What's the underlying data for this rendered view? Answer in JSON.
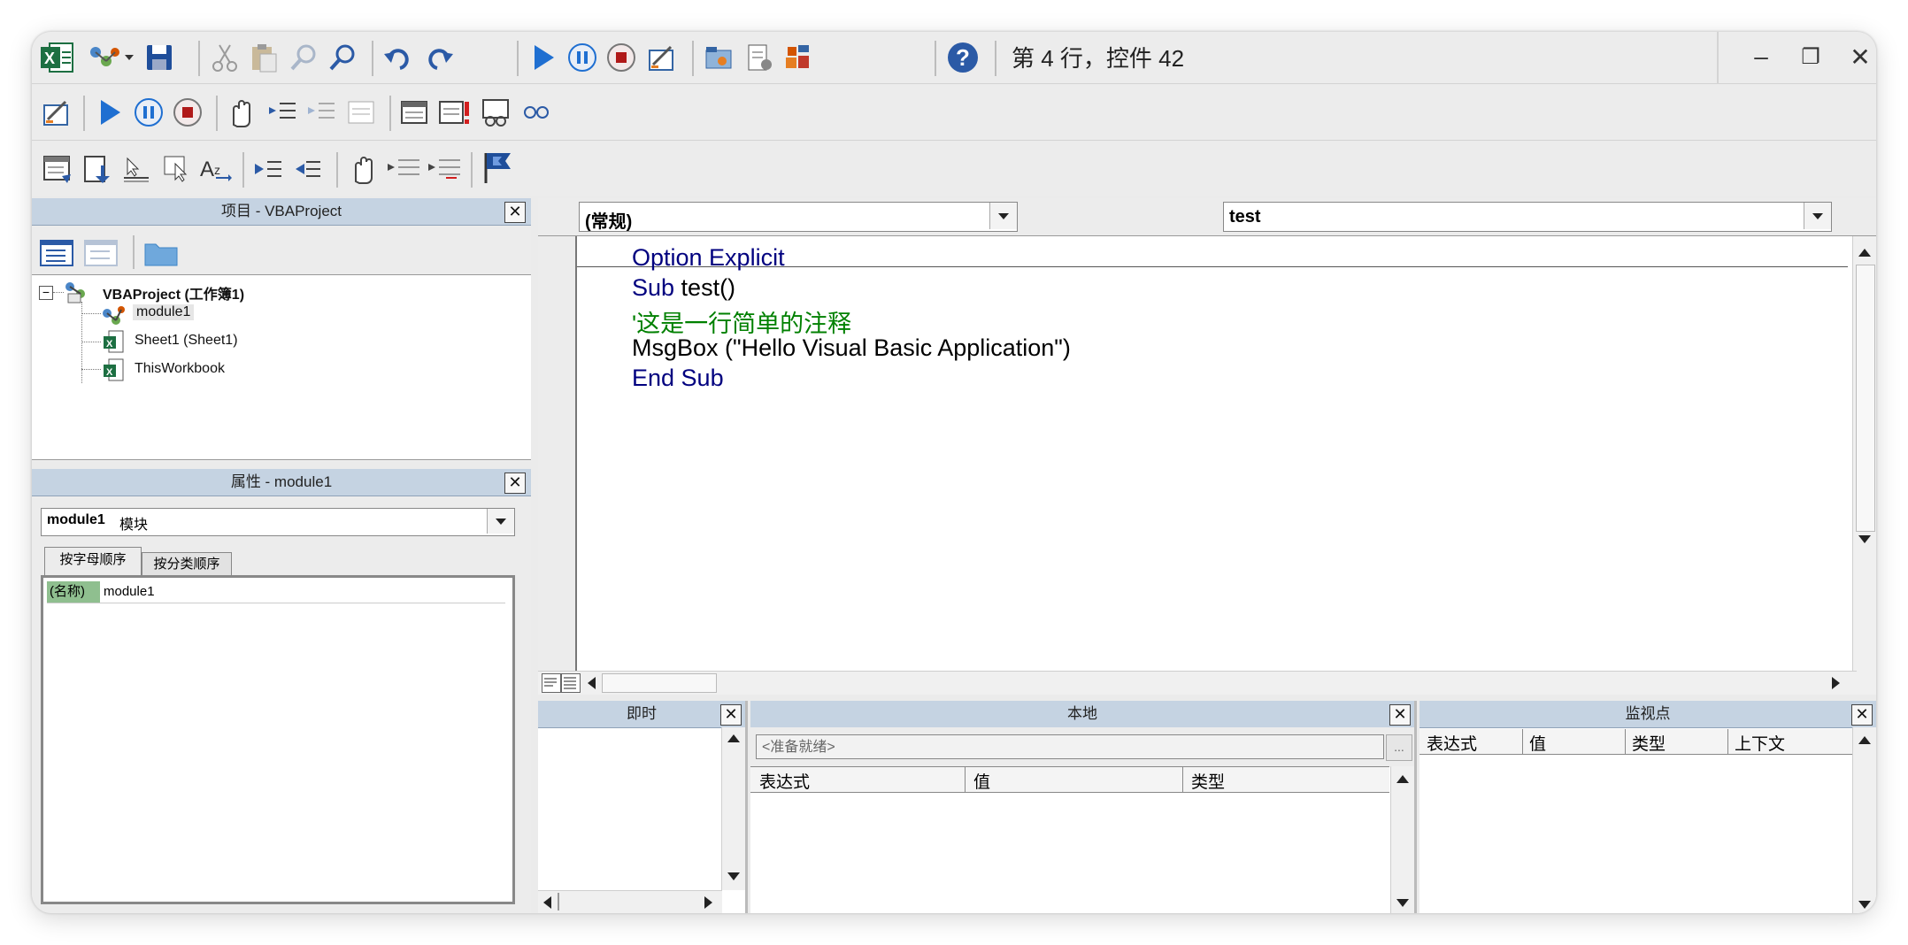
{
  "status_text": "第 4 行，控件 42",
  "window_buttons": {
    "minimize": "–",
    "restore": "❐",
    "close": "✕"
  },
  "project_panel": {
    "title": "项目 - VBAProject",
    "close": "✕",
    "root": "VBAProject (工作簿1)",
    "items": [
      "module1",
      "Sheet1 (Sheet1)",
      "ThisWorkbook"
    ],
    "collapse_sign": "−"
  },
  "properties_panel": {
    "title": "属性 - module1",
    "close": "✕",
    "object_name": "module1",
    "object_type": "模块",
    "tabs": [
      "按字母顺序",
      "按分类顺序"
    ],
    "rows": [
      {
        "name": "(名称)",
        "value": "module1"
      }
    ]
  },
  "code_window": {
    "object_dropdown": "(常规)",
    "procedure_dropdown": "test",
    "lines": [
      {
        "kw": "Option Explicit",
        "rest": ""
      },
      {
        "kw": "Sub",
        "rest": " test()"
      },
      {
        "comment": "'这是一行简单的注释"
      },
      {
        "kw": "",
        "rest": "MsgBox (\"Hello Visual Basic Application\")"
      },
      {
        "kw": "End Sub",
        "rest": ""
      }
    ]
  },
  "immediate_panel": {
    "title": "即时",
    "close": "✕"
  },
  "locals_panel": {
    "title": "本地",
    "close": "✕",
    "context": "<准备就绪>",
    "context_button": "...",
    "columns": [
      "表达式",
      "值",
      "类型"
    ]
  },
  "watch_panel": {
    "title": "监视点",
    "close": "✕",
    "columns": [
      "表达式",
      "值",
      "类型",
      "上下文"
    ]
  },
  "colors": {
    "keyword": "#00007f",
    "comment": "#008000",
    "panel_title": "#c5d3e2",
    "run_blue": "#1f6fd1",
    "stop_red": "#b01818"
  }
}
